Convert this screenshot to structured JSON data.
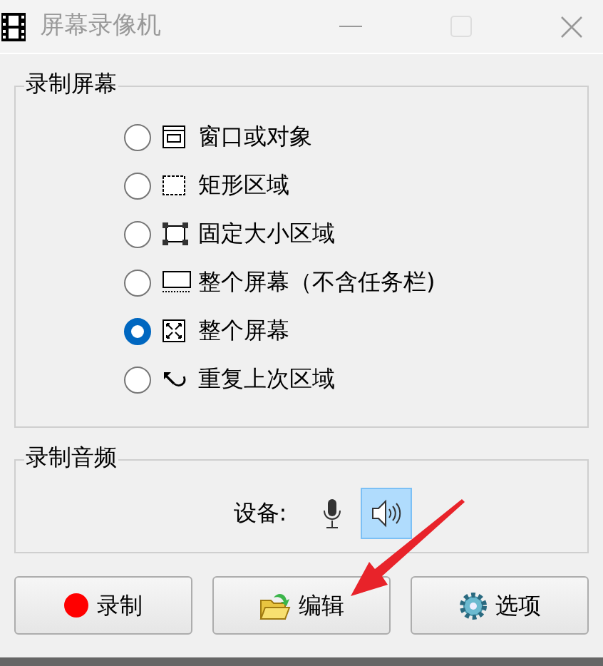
{
  "window": {
    "title": "屏幕录像机"
  },
  "capture_group": {
    "title": "录制屏幕",
    "options": [
      {
        "kind": "window",
        "label": "窗口或对象",
        "selected": false
      },
      {
        "kind": "rect",
        "label": "矩形区域",
        "selected": false
      },
      {
        "kind": "fixed",
        "label": "固定大小区域",
        "selected": false
      },
      {
        "kind": "notaskbar",
        "label": "整个屏幕（不含任务栏)",
        "selected": false
      },
      {
        "kind": "full",
        "label": "整个屏幕",
        "selected": true
      },
      {
        "kind": "repeat",
        "label": "重复上次区域",
        "selected": false
      }
    ]
  },
  "audio_group": {
    "title": "录制音频",
    "device_label": "设备:",
    "devices": [
      {
        "kind": "microphone",
        "selected": false
      },
      {
        "kind": "speaker",
        "selected": true
      }
    ]
  },
  "buttons": [
    {
      "kind": "record",
      "label": "录制"
    },
    {
      "kind": "edit",
      "label": "编辑"
    },
    {
      "kind": "options",
      "label": "选项"
    }
  ]
}
